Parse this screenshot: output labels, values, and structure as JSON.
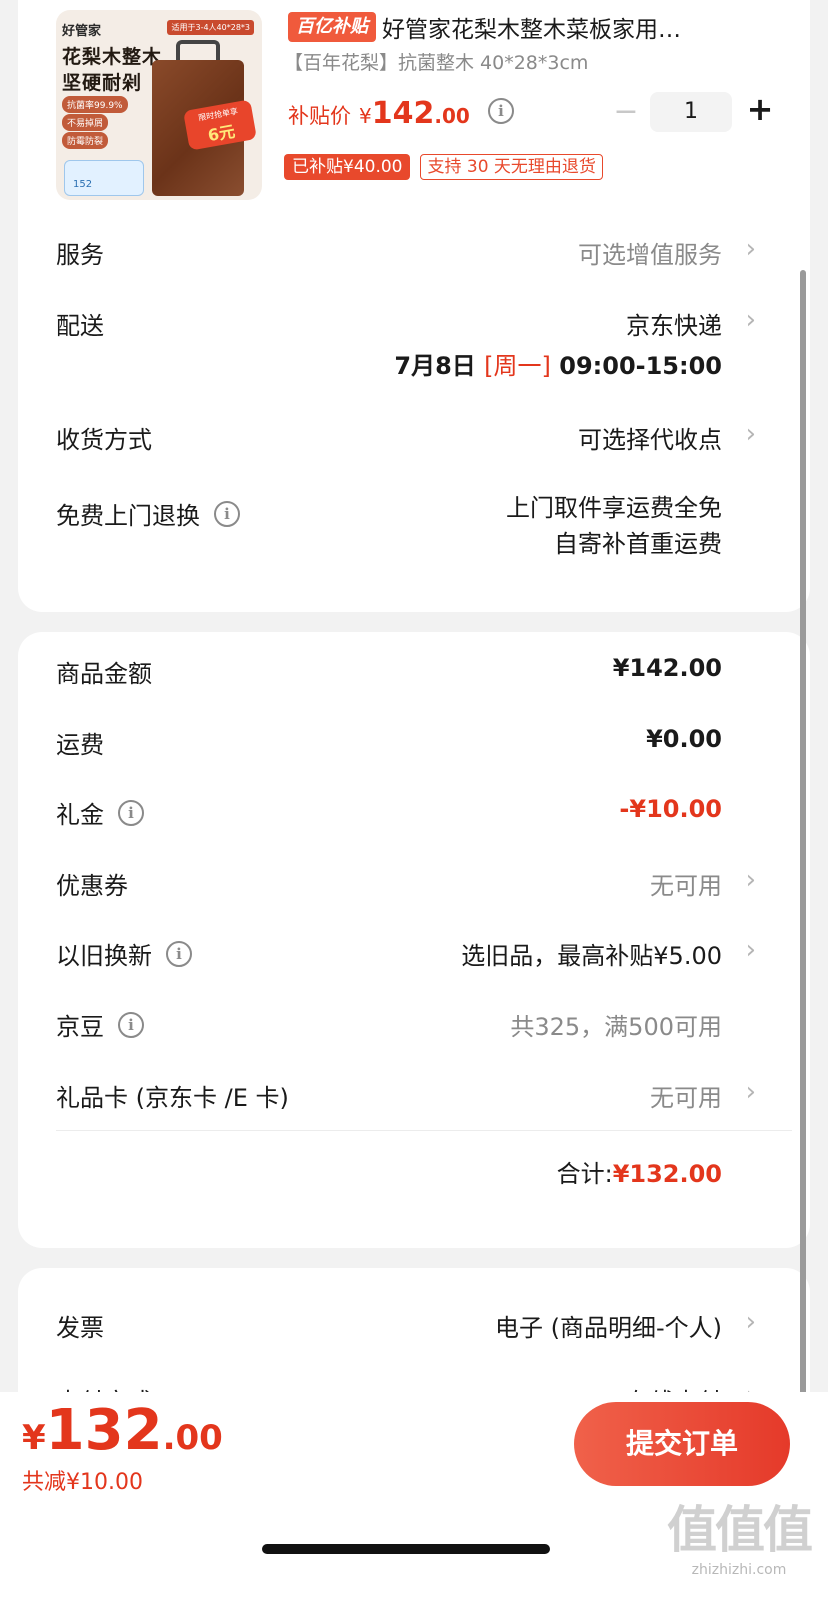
{
  "product": {
    "image": {
      "brand": "好管家",
      "fit": "适用于3-4人40*28*3",
      "headline1": "花梨木整木",
      "headline2": "坚硬耐剁",
      "tags": [
        "抗菌率99.9%",
        "不易掉屑",
        "防霉防裂"
      ],
      "promo_line": "限时抢单享",
      "promo_value": "6元",
      "mini_card": "152"
    },
    "subsidy_logo": "百亿补贴",
    "title": "好管家花梨木整木菜板家用…",
    "spec": "【百年花梨】抗菌整木 40*28*3cm",
    "price_label": "补贴价",
    "price_symbol": "¥",
    "price_int": "142",
    "price_dec": ".00",
    "quantity": "1",
    "minus": "−",
    "plus": "+",
    "badge_subsidized": "已补贴¥40.00",
    "badge_return": "支持 30 天无理由退货"
  },
  "service": {
    "label": "服务",
    "value": "可选增值服务"
  },
  "delivery": {
    "label": "配送",
    "value": "京东快递",
    "date": "7月8日",
    "weekday": "[周一]",
    "time": "09:00-15:00"
  },
  "receive": {
    "label": "收货方式",
    "value": "可选择代收点"
  },
  "free_return": {
    "label": "免费上门退换",
    "line1": "上门取件享运费全免",
    "line2": "自寄补首重运费"
  },
  "summary": {
    "goods": {
      "label": "商品金额",
      "value": "¥142.00"
    },
    "shipping": {
      "label": "运费",
      "value": "¥0.00"
    },
    "gift_cash": {
      "label": "礼金",
      "value": "-¥10.00"
    },
    "coupon": {
      "label": "优惠券",
      "value": "无可用"
    },
    "trade_in": {
      "label": "以旧换新",
      "value": "选旧品，最高补贴¥5.00"
    },
    "jingdou": {
      "label": "京豆",
      "value": "共325，满500可用"
    },
    "gift_card": {
      "label": "礼品卡 (京东卡 /E 卡)",
      "value": "无可用"
    },
    "total_label": "合计:",
    "total_value": "¥132.00"
  },
  "invoice": {
    "label": "发票",
    "value": "电子 (商品明细-个人)"
  },
  "payment": {
    "label": "支付方式",
    "value": "在线支付"
  },
  "bottom": {
    "symbol": "¥",
    "amount_int": "132",
    "amount_dec": ".00",
    "saved": "共减¥10.00",
    "submit": "提交订单"
  },
  "watermark": {
    "logo": "值值值",
    "url": "zhizhizhi.com"
  },
  "icons": {
    "chevron": "chevron-right-icon",
    "info": "info-circle-icon"
  },
  "colors": {
    "accent": "#e3361c",
    "badge": "#e8492c",
    "muted": "#8a8a8a"
  }
}
